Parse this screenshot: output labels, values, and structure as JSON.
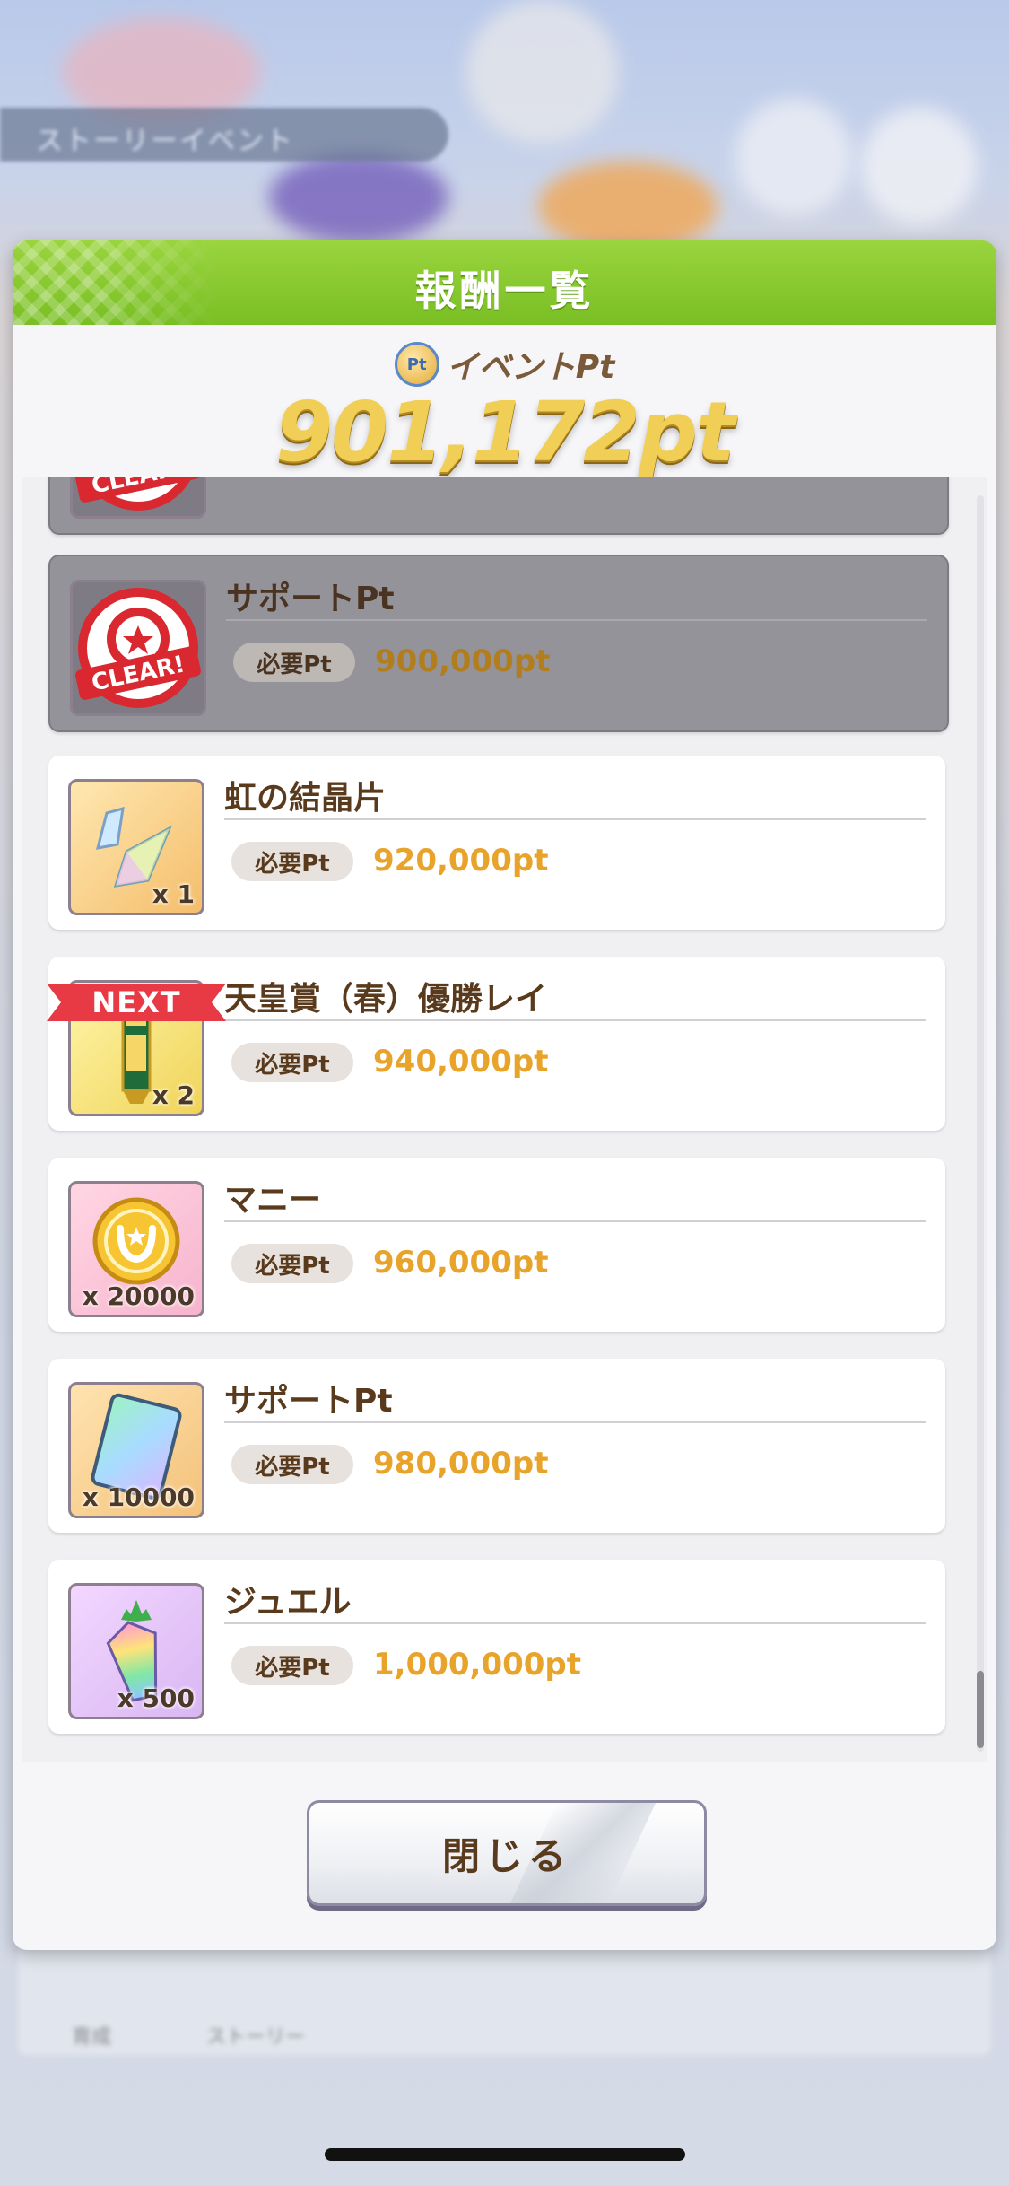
{
  "background": {
    "banner_text": "ストーリーイベント",
    "nav_labels": [
      "育成",
      "ストーリー",
      "",
      "",
      "",
      ""
    ]
  },
  "modal": {
    "title": "報酬一覧",
    "pt_coin": "Pt",
    "pt_label": "イベントPt",
    "pt_value": "901,172pt"
  },
  "rewards": [
    {
      "name": "",
      "required_label": "",
      "required_value": "",
      "qty": "",
      "state": "cleared-partial",
      "icon": "clear-stamp-icon"
    },
    {
      "name": "サポートPt",
      "required_label": "必要Pt",
      "required_value": "900,000pt",
      "qty": "",
      "state": "cleared",
      "icon": "clear-stamp-icon"
    },
    {
      "name": "虹の結晶片",
      "required_label": "必要Pt",
      "required_value": "920,000pt",
      "qty": "x 1",
      "state": "next",
      "icon": "crystal-shard-icon"
    },
    {
      "name": "天皇賞（春）優勝レイ",
      "required_label": "必要Pt",
      "required_value": "940,000pt",
      "qty": "x 2",
      "state": "locked",
      "icon": "victory-lei-icon"
    },
    {
      "name": "マニー",
      "required_label": "必要Pt",
      "required_value": "960,000pt",
      "qty": "x 20000",
      "state": "locked",
      "icon": "money-coin-icon"
    },
    {
      "name": "サポートPt",
      "required_label": "必要Pt",
      "required_value": "980,000pt",
      "qty": "x 10000",
      "state": "locked",
      "icon": "support-card-icon"
    },
    {
      "name": "ジュエル",
      "required_label": "必要Pt",
      "required_value": "1,000,000pt",
      "qty": "x 500",
      "state": "locked",
      "icon": "jewel-icon"
    }
  ],
  "next_badge": "NEXT",
  "clear_text": "CLEAR!",
  "close_button": "閉じる",
  "colors": {
    "header_green": "#8fcf32",
    "value_gold": "#e8a32a",
    "next_red": "#e83a44",
    "cleared_gray": "#94939a"
  }
}
